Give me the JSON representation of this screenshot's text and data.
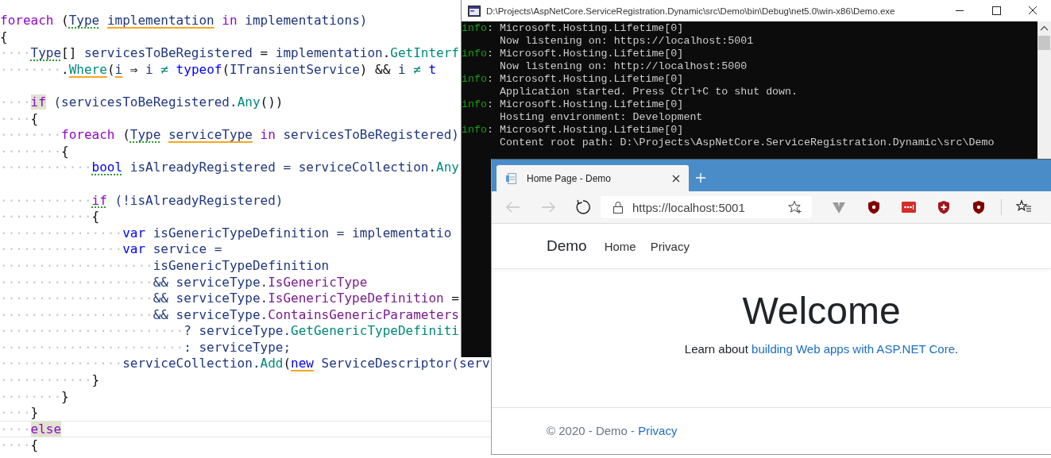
{
  "editor": {
    "lines": [
      {
        "kind": "code",
        "tokens": [
          {
            "text": "foreach",
            "kind": "ctrl"
          },
          {
            "text": " (",
            "kind": "punct"
          },
          {
            "text": "Type",
            "kind": "id",
            "suggestion": true
          },
          {
            "text": " implementation",
            "kind": "id",
            "warning": true
          },
          {
            "text": " in",
            "kind": "ctrl"
          },
          {
            "text": " implementations)",
            "kind": "id"
          }
        ]
      },
      {
        "kind": "code",
        "tokens": [
          {
            "text": "{",
            "kind": "punct"
          }
        ]
      },
      {
        "kind": "code",
        "tokens": [
          {
            "text": "····",
            "kind": "ws"
          },
          {
            "text": "Type",
            "kind": "id",
            "suggestion": true
          },
          {
            "text": "[] ",
            "kind": "punct"
          },
          {
            "text": "servicesToBeRegistered",
            "kind": "id"
          },
          {
            "text": " = ",
            "kind": "punct"
          },
          {
            "text": "implementation",
            "kind": "id"
          },
          {
            "text": ".",
            "kind": "punct"
          },
          {
            "text": "GetInterf",
            "kind": "method"
          }
        ]
      },
      {
        "kind": "code",
        "tokens": [
          {
            "text": "········",
            "kind": "ws"
          },
          {
            "text": ".",
            "kind": "punct"
          },
          {
            "text": "Where",
            "kind": "method",
            "warning": true
          },
          {
            "text": "(",
            "kind": "punct"
          },
          {
            "text": "i",
            "kind": "id",
            "warning": true
          },
          {
            "text": " ⇒ ",
            "kind": "punct"
          },
          {
            "text": "i",
            "kind": "id"
          },
          {
            "text": " ≠ ",
            "kind": "method"
          },
          {
            "text": "typeof",
            "kind": "kw"
          },
          {
            "text": "(",
            "kind": "punct"
          },
          {
            "text": "ITransientService",
            "kind": "id"
          },
          {
            "text": ") && ",
            "kind": "punct"
          },
          {
            "text": "i",
            "kind": "id"
          },
          {
            "text": " ≠ ",
            "kind": "method"
          },
          {
            "text": "t",
            "kind": "kw"
          }
        ]
      },
      {
        "kind": "blank"
      },
      {
        "kind": "code",
        "tokens": [
          {
            "text": "····",
            "kind": "ws"
          },
          {
            "text": "if",
            "kind": "ctrl",
            "highlighted": true
          },
          {
            "text": " (servicesToBeRegistered.",
            "kind": "id"
          },
          {
            "text": "Any",
            "kind": "method"
          },
          {
            "text": "())",
            "kind": "punct"
          }
        ]
      },
      {
        "kind": "code",
        "tokens": [
          {
            "text": "····",
            "kind": "ws"
          },
          {
            "text": "{",
            "kind": "punct"
          }
        ]
      },
      {
        "kind": "code",
        "tokens": [
          {
            "text": "········",
            "kind": "ws"
          },
          {
            "text": "foreach",
            "kind": "ctrl"
          },
          {
            "text": " (",
            "kind": "punct"
          },
          {
            "text": "Type",
            "kind": "id",
            "suggestion": true
          },
          {
            "text": " serviceType",
            "kind": "id",
            "warning": true
          },
          {
            "text": " in",
            "kind": "ctrl"
          },
          {
            "text": " servicesToBeRegistered)",
            "kind": "id"
          }
        ]
      },
      {
        "kind": "code",
        "tokens": [
          {
            "text": "········",
            "kind": "ws"
          },
          {
            "text": "{",
            "kind": "punct"
          }
        ]
      },
      {
        "kind": "code",
        "tokens": [
          {
            "text": "············",
            "kind": "ws"
          },
          {
            "text": "bool",
            "kind": "kw",
            "suggestion": true
          },
          {
            "text": " isAlreadyRegistered = serviceCollection.",
            "kind": "id"
          },
          {
            "text": "Any",
            "kind": "method"
          }
        ]
      },
      {
        "kind": "blank"
      },
      {
        "kind": "code",
        "tokens": [
          {
            "text": "············",
            "kind": "ws"
          },
          {
            "text": "if",
            "kind": "ctrl",
            "suggestion": true
          },
          {
            "text": " (!isAlreadyRegistered)",
            "kind": "id"
          }
        ]
      },
      {
        "kind": "code",
        "tokens": [
          {
            "text": "············",
            "kind": "ws"
          },
          {
            "text": "{",
            "kind": "punct"
          }
        ]
      },
      {
        "kind": "code",
        "tokens": [
          {
            "text": "················",
            "kind": "ws"
          },
          {
            "text": "var",
            "kind": "kw"
          },
          {
            "text": " isGenericTypeDefinition = implementatio",
            "kind": "id"
          }
        ]
      },
      {
        "kind": "code",
        "tokens": [
          {
            "text": "················",
            "kind": "ws"
          },
          {
            "text": "var",
            "kind": "kw"
          },
          {
            "text": " service =",
            "kind": "id"
          }
        ]
      },
      {
        "kind": "code",
        "tokens": [
          {
            "text": "····················",
            "kind": "ws"
          },
          {
            "text": "isGenericTypeDefinition",
            "kind": "id"
          }
        ]
      },
      {
        "kind": "code",
        "tokens": [
          {
            "text": "····················",
            "kind": "ws"
          },
          {
            "text": "&& serviceType.",
            "kind": "id"
          },
          {
            "text": "IsGenericType",
            "kind": "prop"
          }
        ]
      },
      {
        "kind": "code",
        "tokens": [
          {
            "text": "····················",
            "kind": "ws"
          },
          {
            "text": "&& serviceType.",
            "kind": "id"
          },
          {
            "text": "IsGenericTypeDefinition",
            "kind": "prop"
          },
          {
            "text": " =",
            "kind": "punct"
          }
        ]
      },
      {
        "kind": "code",
        "tokens": [
          {
            "text": "····················",
            "kind": "ws"
          },
          {
            "text": "&& serviceType.",
            "kind": "id"
          },
          {
            "text": "ContainsGenericParameters",
            "kind": "prop"
          }
        ]
      },
      {
        "kind": "code",
        "tokens": [
          {
            "text": "························",
            "kind": "ws"
          },
          {
            "text": "? serviceType.",
            "kind": "id"
          },
          {
            "text": "GetGenericTypeDefiniti",
            "kind": "method"
          }
        ]
      },
      {
        "kind": "code",
        "tokens": [
          {
            "text": "························",
            "kind": "ws"
          },
          {
            "text": ": serviceType;",
            "kind": "id"
          }
        ]
      },
      {
        "kind": "code",
        "tokens": [
          {
            "text": "················",
            "kind": "ws"
          },
          {
            "text": "serviceCollection.",
            "kind": "id"
          },
          {
            "text": "Add",
            "kind": "method"
          },
          {
            "text": "(",
            "kind": "punct"
          },
          {
            "text": "new",
            "kind": "kw",
            "warning": true
          },
          {
            "text": " ServiceDescriptor(serv",
            "kind": "id"
          }
        ]
      },
      {
        "kind": "code",
        "tokens": [
          {
            "text": "············",
            "kind": "ws"
          },
          {
            "text": "}",
            "kind": "punct"
          }
        ]
      },
      {
        "kind": "code",
        "tokens": [
          {
            "text": "········",
            "kind": "ws"
          },
          {
            "text": "}",
            "kind": "punct"
          }
        ]
      },
      {
        "kind": "code",
        "tokens": [
          {
            "text": "····",
            "kind": "ws"
          },
          {
            "text": "}",
            "kind": "punct"
          }
        ]
      },
      {
        "kind": "current",
        "tokens": [
          {
            "text": "····",
            "kind": "ws"
          },
          {
            "text": "else",
            "kind": "ctrl",
            "highlighted": true
          }
        ]
      },
      {
        "kind": "code",
        "tokens": [
          {
            "text": "····",
            "kind": "ws"
          },
          {
            "text": "{",
            "kind": "punct"
          }
        ]
      }
    ]
  },
  "console": {
    "title": "D:\\Projects\\AspNetCore.ServiceRegistration.Dynamic\\src\\Demo\\bin\\Debug\\net5.0\\win-x86\\Demo.exe",
    "entries": [
      {
        "level": "info",
        "source": ": Microsoft.Hosting.Lifetime[0]",
        "message": "Now listening on: https://localhost:5001"
      },
      {
        "level": "info",
        "source": ": Microsoft.Hosting.Lifetime[0]",
        "message": "Now listening on: http://localhost:5000"
      },
      {
        "level": "info",
        "source": ": Microsoft.Hosting.Lifetime[0]",
        "message": "Application started. Press Ctrl+C to shut down."
      },
      {
        "level": "info",
        "source": ": Microsoft.Hosting.Lifetime[0]",
        "message": "Hosting environment: Development"
      },
      {
        "level": "info",
        "source": ": Microsoft.Hosting.Lifetime[0]",
        "message": "Content root path: D:\\Projects\\AspNetCore.ServiceRegistration.Dynamic\\src\\Demo"
      }
    ]
  },
  "browser": {
    "tabs": [
      {
        "title": "Home Page - Demo",
        "selected": true
      }
    ],
    "toolbar": {
      "back": {
        "disabled": true
      },
      "forward": {
        "disabled": true
      }
    },
    "address": {
      "value": "https://localhost:5001"
    },
    "extensions": [
      {
        "kind": "vee"
      },
      {
        "kind": "shield_ub"
      },
      {
        "kind": "dots"
      },
      {
        "kind": "shield_plus"
      },
      {
        "kind": "shield_ub"
      }
    ],
    "page": {
      "brand": "Demo",
      "nav_links": [
        "Home",
        "Privacy"
      ],
      "heading": "Welcome",
      "intro": {
        "before": "Learn about ",
        "link": "building Web apps with ASP.NET Core",
        "after": "."
      },
      "footer": {
        "text": "© 2020 - Demo - ",
        "link": "Privacy"
      }
    }
  }
}
